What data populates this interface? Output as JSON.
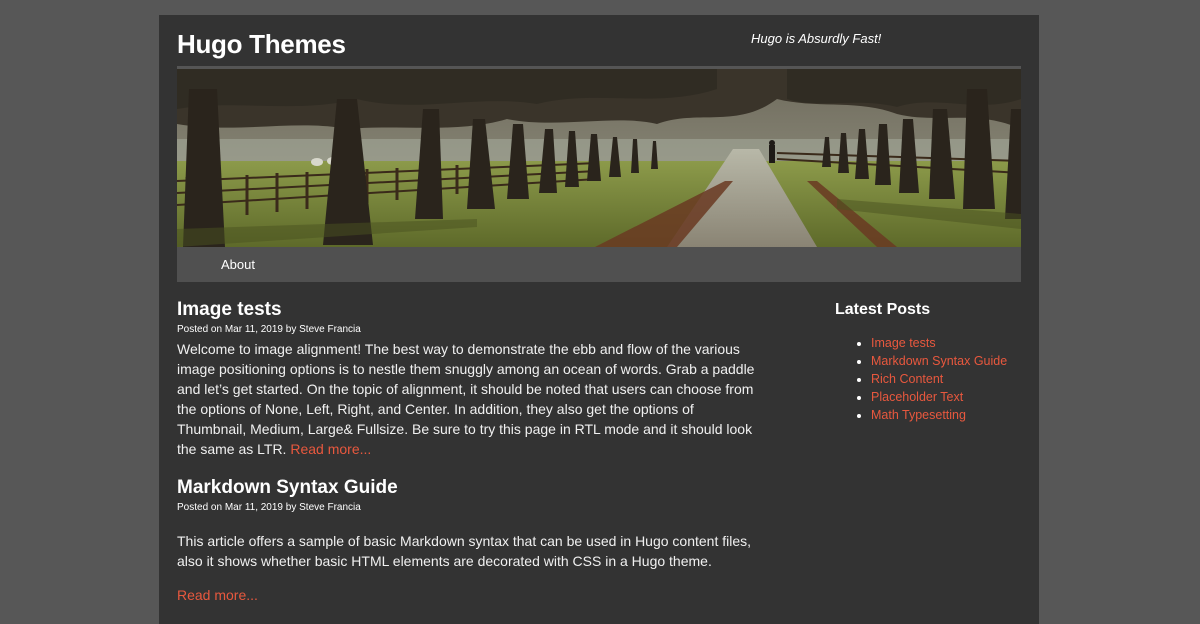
{
  "site": {
    "title": "Hugo Themes",
    "tagline": "Hugo is Absurdly Fast!"
  },
  "nav": {
    "items": [
      {
        "label": "About"
      }
    ]
  },
  "posts": [
    {
      "title": "Image tests",
      "meta": "Posted on Mar 11, 2019 by Steve Francia",
      "summary": "Welcome to image alignment! The best way to demonstrate the ebb and flow of the various image positioning options is to nestle them snuggly among an ocean of words. Grab a paddle and let’s get started. On the topic of alignment, it should be noted that users can choose from the options of None, Left, Right, and Center. In addition, they also get the options of Thumbnail, Medium, Large& Fullsize. Be sure to try this page in RTL mode and it should look the same as LTR.",
      "read_more": "Read more..."
    },
    {
      "title": "Markdown Syntax Guide",
      "meta": "Posted on Mar 11, 2019 by Steve Francia",
      "summary": "This article offers a sample of basic Markdown syntax that can be used in Hugo content files, also it shows whether basic HTML elements are decorated with CSS in a Hugo theme.",
      "read_more": "Read more..."
    }
  ],
  "sidebar": {
    "heading": "Latest Posts",
    "items": [
      {
        "label": "Image tests"
      },
      {
        "label": "Markdown Syntax Guide"
      },
      {
        "label": "Rich Content"
      },
      {
        "label": "Placeholder Text"
      },
      {
        "label": "Math Typesetting"
      }
    ]
  },
  "colors": {
    "page_background": "#575757",
    "container_background": "#333333",
    "nav_background": "#505050",
    "link_accent": "#e8583e",
    "text": "#ffffff"
  },
  "icons": {
    "banner_image": "tree-lined-path-photo",
    "bullet": "disc-bullet-icon"
  }
}
